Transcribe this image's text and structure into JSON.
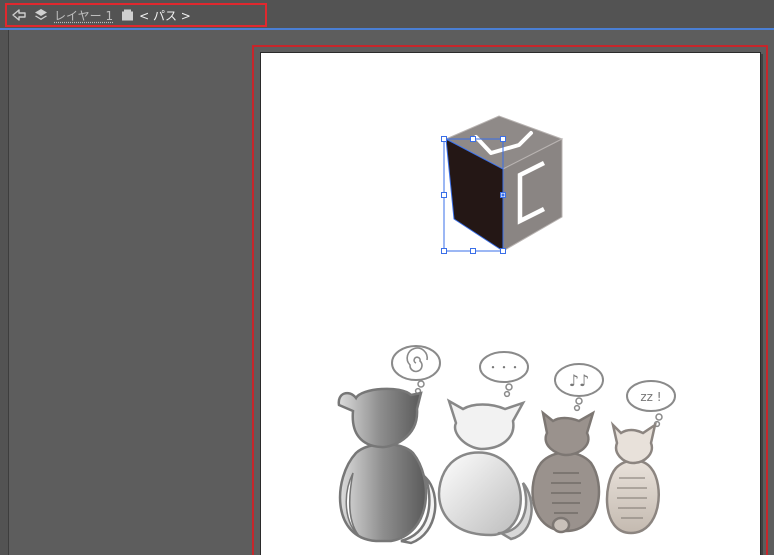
{
  "breadcrumb": {
    "back_icon": "back-arrow-icon",
    "layer_icon": "layers-icon",
    "layer_label": "レイヤー 1",
    "group_icon": "clip-group-icon",
    "path_label": "< パス >"
  },
  "canvas": {
    "cube_logo_letters": "UC",
    "bubbles": [
      {
        "content": "spiral"
      },
      {
        "content": "・・・"
      },
      {
        "content": "♪♪"
      },
      {
        "content": "zz !"
      }
    ]
  },
  "colors": {
    "selection": "#3a6fe8",
    "breadcrumb_highlight": "#e0282e",
    "artboard_highlight": "#c7262b",
    "cube_dark_face": "#241715",
    "cube_gray": "#8f8a88"
  }
}
